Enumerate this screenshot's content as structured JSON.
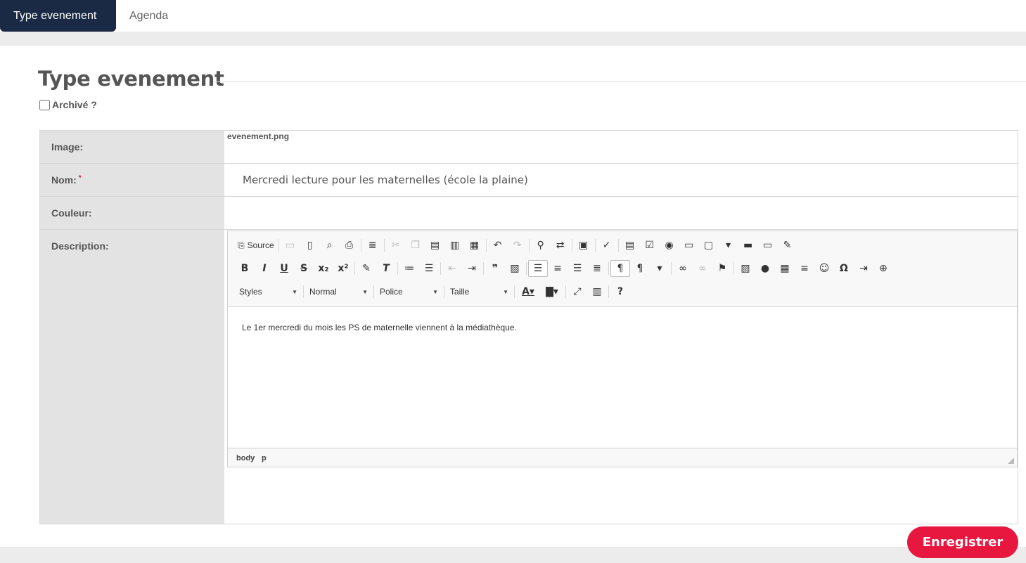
{
  "tabs": [
    {
      "label": "Type evenement",
      "active": true
    },
    {
      "label": "Agenda",
      "active": false
    }
  ],
  "page_title": "Type evenement",
  "archive_label": "Archivé ?",
  "archive_checked": false,
  "form": {
    "image_label": "Image:",
    "image_value": "evenement.png",
    "nom_label": "Nom:",
    "nom_required": "*",
    "nom_value": "Mercredi lecture pour les maternelles (école la plaine)",
    "couleur_label": "Couleur:",
    "description_label": "Description:"
  },
  "editor": {
    "source_label": "Source",
    "styles_combo": "Styles",
    "format_combo": "Normal",
    "font_combo": "Police",
    "size_combo": "Taille",
    "help_label": "?",
    "content": "Le 1er mercredi du mois les PS de maternelle viennent à la médiathèque.",
    "path": [
      "body",
      "p"
    ]
  },
  "save_button": "Enregistrer",
  "colors": {
    "tab_active": "#1b2a44",
    "accent": "#e8173f"
  }
}
